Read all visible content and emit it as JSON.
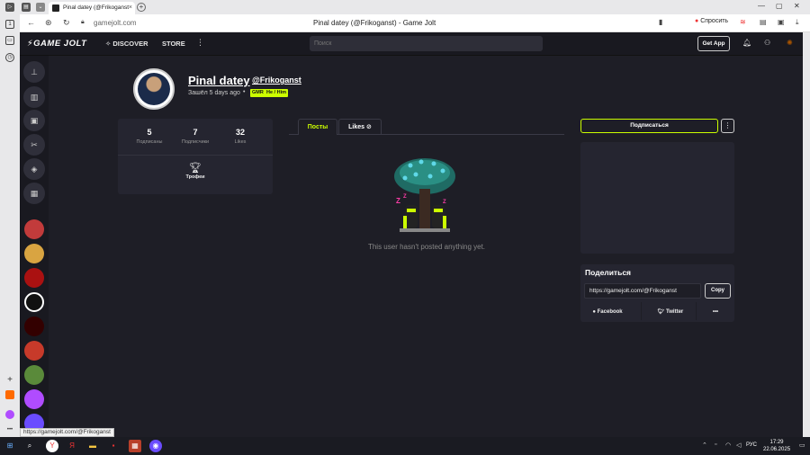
{
  "browser": {
    "tab_title": "Pinal datey (@Frikoganst",
    "tab_close": "×",
    "new_tab": "+",
    "url": "gamejolt.com",
    "page_title": "Pinal datey (@Frikoganst) - Game Jolt",
    "ask_label": "Спросить",
    "status_url": "https://gamejolt.com/@Frikoganst"
  },
  "nav": {
    "logo": "GAME JOLT",
    "discover": "DISCOVER",
    "store": "STORE",
    "more": "⋮",
    "search_placeholder": "Поиск",
    "get_app": "Get App"
  },
  "profile": {
    "display_name": "Pinal datey",
    "username": "@Frikoganst",
    "last_seen": "Зашёл 5 days ago",
    "separator": "•",
    "tags": [
      "GMR",
      "He / Him"
    ]
  },
  "stats": [
    {
      "value": "5",
      "label": "Подписаны"
    },
    {
      "value": "7",
      "label": "Подписчики"
    },
    {
      "value": "32",
      "label": "Likes"
    }
  ],
  "trophy_label": "Трофеи",
  "tabs": {
    "posts": "Посты",
    "likes": "Likes"
  },
  "empty_text": "This user hasn't posted anything yet.",
  "follow": {
    "label": "Подписаться",
    "more": "⋮"
  },
  "share": {
    "title": "Поделиться",
    "url": "https://gamejolt.com/@Frikoganst",
    "copy": "Copy",
    "facebook": "Facebook",
    "twitter": "Twitter",
    "more": "•••"
  },
  "taskbar": {
    "lang": "РУС",
    "time": "17:29",
    "date": "22.06.2025"
  },
  "colors": {
    "accent": "#ccff00",
    "bg": "#1e1e26",
    "card": "#252530"
  }
}
